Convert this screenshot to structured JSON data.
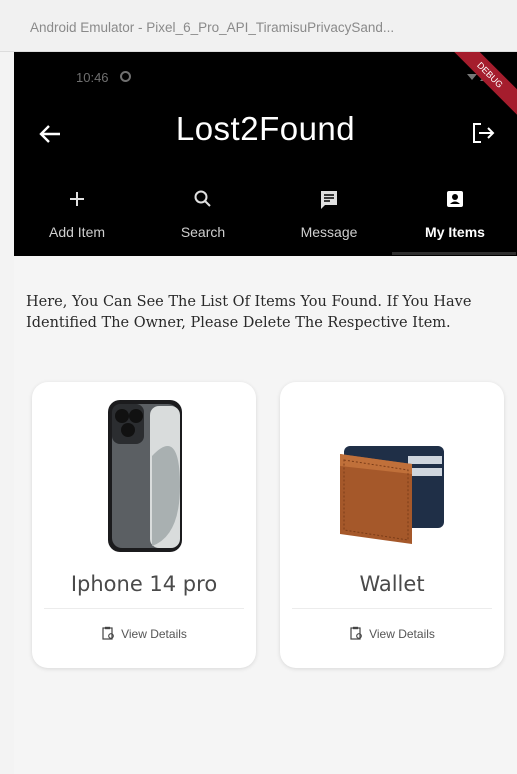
{
  "window": {
    "title": "Android Emulator - Pixel_6_Pro_API_TiramisuPrivacySand..."
  },
  "status_bar": {
    "time": "10:46",
    "debug_banner": "DEBUG"
  },
  "app_bar": {
    "title": "Lost2Found",
    "back_icon": "arrow-left-icon",
    "logout_icon": "logout-icon"
  },
  "tabs": [
    {
      "label": "Add Item",
      "icon": "plus-icon",
      "active": false
    },
    {
      "label": "Search",
      "icon": "search-icon",
      "active": false
    },
    {
      "label": "Message",
      "icon": "message-icon",
      "active": false
    },
    {
      "label": "My Items",
      "icon": "person-card-icon",
      "active": true
    }
  ],
  "intro_text": "Here, You Can See The List Of Items You Found. If You Have Identified The Owner, Please Delete The Respective Item.",
  "items": [
    {
      "name": "Iphone 14 pro",
      "action": "View Details",
      "image": "iphone-image"
    },
    {
      "name": "Wallet",
      "action": "View Details",
      "image": "wallet-image"
    }
  ],
  "colors": {
    "app_bar": "#000000",
    "background": "#f5f5f5",
    "card": "#ffffff"
  }
}
